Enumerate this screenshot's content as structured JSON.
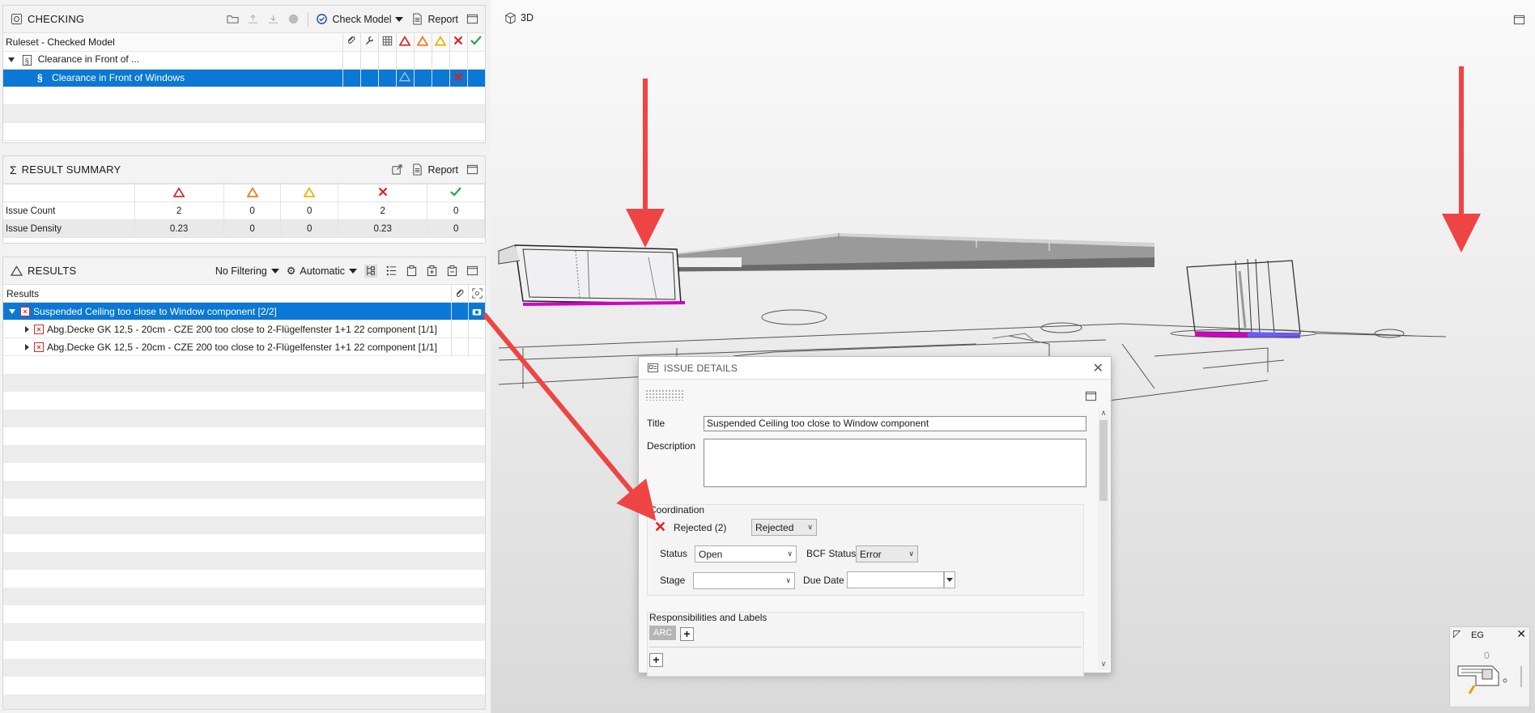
{
  "colors": {
    "accent": "#0a78d4",
    "critical": "#d42a2a",
    "major": "#f07c1c",
    "minor": "#e8b400",
    "rejected": "#e01f1f",
    "approved": "#23a84d",
    "magenta": "#d000c8",
    "annotation_arrow": "#ef4444"
  },
  "checking": {
    "title": "CHECKING",
    "check_model_label": "Check Model",
    "report_label": "Report",
    "column_header": "Ruleset - Checked Model",
    "rows": [
      {
        "label": "Clearance in Front of ...",
        "icons": [
          "expand-down",
          "ruleset-icon"
        ]
      },
      {
        "label": "Clearance in Front of Windows",
        "icons": [
          "rule-icon"
        ],
        "flags": [
          "minor-outline",
          "rejected"
        ]
      }
    ]
  },
  "summary": {
    "title": "RESULT SUMMARY",
    "report_label": "Report",
    "rows": [
      {
        "label": "Issue Count",
        "values": [
          "2",
          "0",
          "0",
          "2",
          "0"
        ]
      },
      {
        "label": "Issue Density",
        "values": [
          "0.23",
          "0",
          "0",
          "0.23",
          "0"
        ]
      }
    ]
  },
  "results": {
    "title": "RESULTS",
    "filter_label": "No Filtering",
    "mode_label": "Automatic",
    "column_header": "Results",
    "rows": [
      {
        "label": "Suspended Ceiling too close to Window component [2/2]",
        "selected": true
      },
      {
        "label": "Abg.Decke GK 12,5 - 20cm - CZE 200 too close to 2-Flügelfenster 1+1 22 component [1/1]"
      },
      {
        "label": "Abg.Decke GK 12,5 - 20cm - CZE 200 too close to 2-Flügelfenster 1+1 22 component [1/1]"
      }
    ]
  },
  "view": {
    "title": "3D"
  },
  "issue": {
    "dialog_title": "ISSUE DETAILS",
    "title_label": "Title",
    "title_value": "Suspended Ceiling too close to Window component",
    "description_label": "Description",
    "description_value": "",
    "coordination_label": "Coordination",
    "rejected_text": "Rejected (2)",
    "rejected_select": "Rejected",
    "status_label": "Status",
    "status_value": "Open",
    "bcf_label": "BCF Status",
    "bcf_value": "Error",
    "stage_label": "Stage",
    "stage_value": "",
    "due_label": "Due Date",
    "due_value": "",
    "responsibilities_label": "Responsibilities and Labels",
    "chip_label": "ARC"
  },
  "minimap": {
    "level_label": "EG",
    "zero_label": "0"
  }
}
